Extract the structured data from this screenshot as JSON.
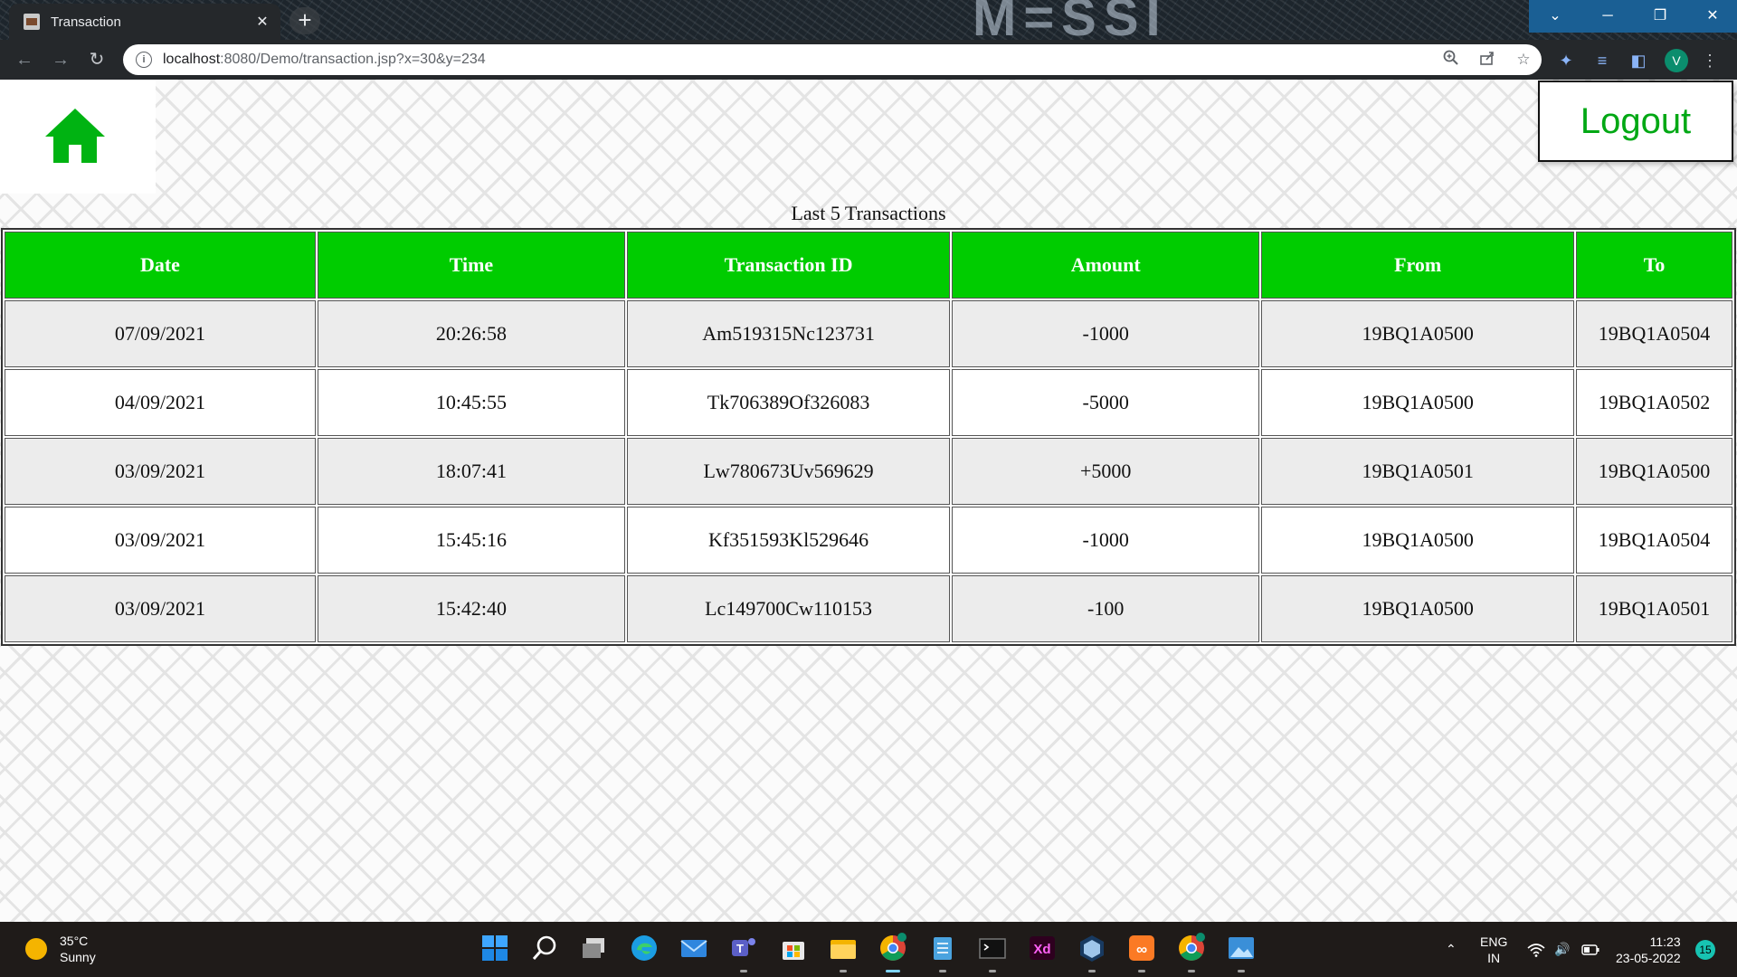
{
  "browser": {
    "tab_title": "Transaction",
    "tab_close": "✕",
    "new_tab": "+",
    "brand_watermark": "M=SSI",
    "url_host": "localhost",
    "url_path": ":8080/Demo/transaction.jsp?x=30&y=234",
    "profile_initial": "V",
    "window_buttons": {
      "down": "⌄",
      "minimize": "─",
      "maximize": "❐",
      "close": "✕"
    }
  },
  "page": {
    "logout_label": "Logout",
    "table_caption": "Last 5 Transactions",
    "accent_color": "#00cc00",
    "columns": [
      "Date",
      "Time",
      "Transaction ID",
      "Amount",
      "From",
      "To"
    ],
    "rows": [
      [
        "07/09/2021",
        "20:26:58",
        "Am519315Nc123731",
        "-1000",
        "19BQ1A0500",
        "19BQ1A0504"
      ],
      [
        "04/09/2021",
        "10:45:55",
        "Tk706389Of326083",
        "-5000",
        "19BQ1A0500",
        "19BQ1A0502"
      ],
      [
        "03/09/2021",
        "18:07:41",
        "Lw780673Uv569629",
        "+5000",
        "19BQ1A0501",
        "19BQ1A0500"
      ],
      [
        "03/09/2021",
        "15:45:16",
        "Kf351593Kl529646",
        "-1000",
        "19BQ1A0500",
        "19BQ1A0504"
      ],
      [
        "03/09/2021",
        "15:42:40",
        "Lc149700Cw110153",
        "-100",
        "19BQ1A0500",
        "19BQ1A0501"
      ]
    ]
  },
  "taskbar": {
    "weather_temp": "35°C",
    "weather_desc": "Sunny",
    "lang_line1": "ENG",
    "lang_line2": "IN",
    "time": "11:23",
    "date": "23-05-2022",
    "notification_count": "15",
    "apps": [
      "start",
      "search",
      "task-view",
      "edge",
      "mail",
      "teams",
      "store",
      "file-explorer",
      "chrome",
      "notepad",
      "terminal",
      "xd",
      "virtualbox",
      "xampp",
      "chrome-profile",
      "photos"
    ]
  }
}
